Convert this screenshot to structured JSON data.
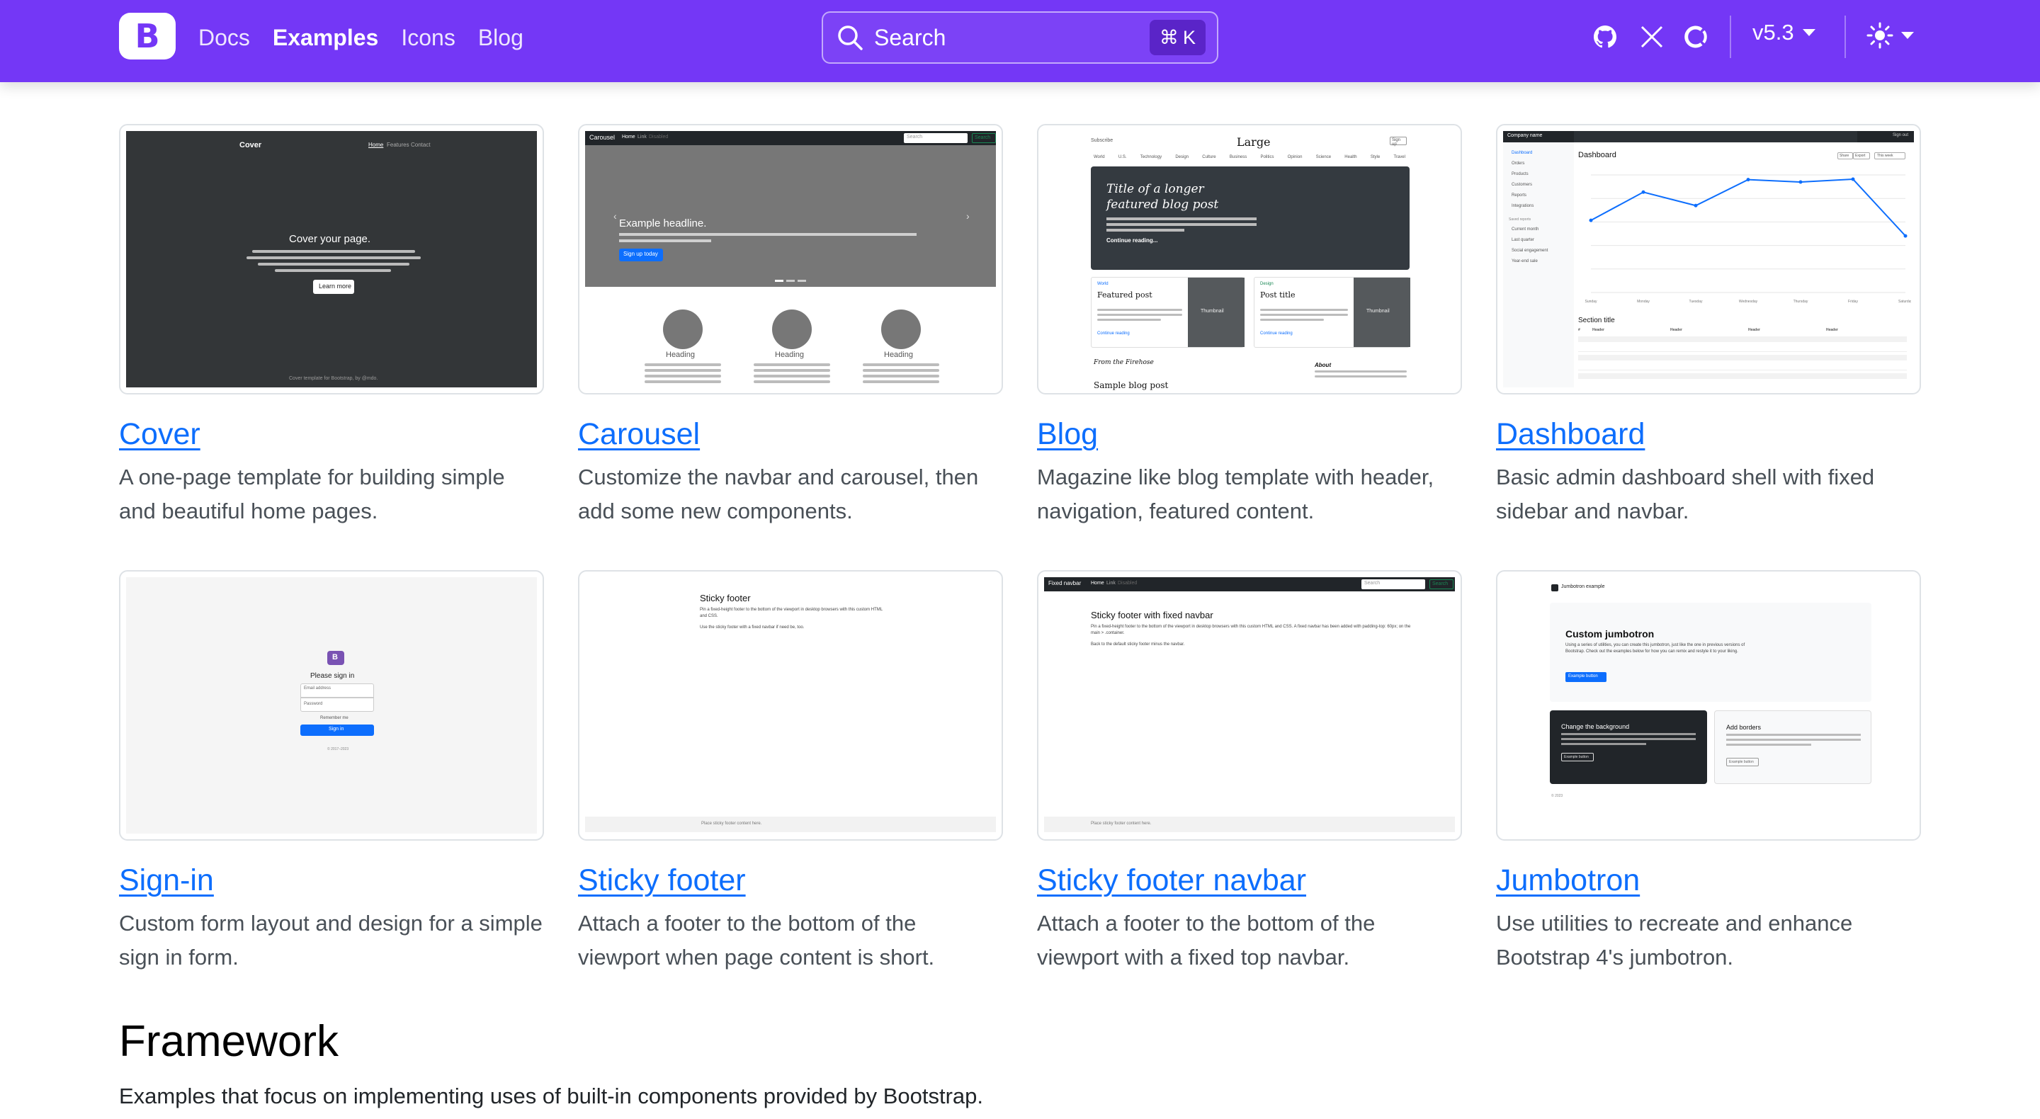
{
  "navbar": {
    "brand_letter": "B",
    "links": [
      {
        "label": "Docs",
        "active": false
      },
      {
        "label": "Examples",
        "active": true
      },
      {
        "label": "Icons",
        "active": false
      },
      {
        "label": "Blog",
        "active": false
      }
    ],
    "search": {
      "label": "Search",
      "shortcut_symbol": "⌘",
      "shortcut_key": "K"
    },
    "version": "v5.3",
    "icons": [
      "github-icon",
      "x-twitter-icon",
      "opencollective-icon",
      "sun-icon"
    ],
    "background_color": "#7437f6"
  },
  "examples": [
    {
      "title": "Cover",
      "description": "A one-page template for building simple and beautiful home pages."
    },
    {
      "title": "Carousel",
      "description": "Customize the navbar and carousel, then add some new components."
    },
    {
      "title": "Blog",
      "description": "Magazine like blog template with header, navigation, featured content."
    },
    {
      "title": "Dashboard",
      "description": "Basic admin dashboard shell with fixed sidebar and navbar."
    },
    {
      "title": "Sign-in",
      "description": "Custom form layout and design for a simple sign in form."
    },
    {
      "title": "Sticky footer",
      "description": "Attach a footer to the bottom of the viewport when page content is short."
    },
    {
      "title": "Sticky footer navbar",
      "description": "Attach a footer to the bottom of the viewport with a fixed top navbar."
    },
    {
      "title": "Jumbotron",
      "description": "Use utilities to recreate and enhance Bootstrap 4's jumbotron."
    }
  ],
  "thumbs": {
    "cover": {
      "brand": "Cover",
      "nav": [
        "Home",
        "Features",
        "Contact"
      ],
      "headline": "Cover your page.",
      "button": "Learn more",
      "footer": "Cover template for Bootstrap, by @mdo."
    },
    "carousel": {
      "brand": "Carousel",
      "nav": [
        "Home",
        "Link",
        "Disabled"
      ],
      "search": "Search",
      "search_button": "Search",
      "headline": "Example headline.",
      "button": "Sign up today",
      "headings": [
        "Heading",
        "Heading",
        "Heading"
      ]
    },
    "blog": {
      "subscribe": "Subscribe",
      "title": "Large",
      "signup": "Sign up",
      "nav": [
        "World",
        "U.S.",
        "Technology",
        "Design",
        "Culture",
        "Business",
        "Politics",
        "Opinion",
        "Science",
        "Health",
        "Style",
        "Travel"
      ],
      "hero_line1": "Title of a longer",
      "hero_line2": "featured blog post",
      "hero_link": "Continue reading...",
      "card1_tag": "World",
      "card1_title": "Featured post",
      "card2_tag": "Design",
      "card2_title": "Post title",
      "thumbnail": "Thumbnail",
      "continue": "Continue reading",
      "firehose": "From the Firehose",
      "sample": "Sample blog post",
      "about": "About"
    },
    "dashboard": {
      "company": "Company name",
      "signout": "Sign out",
      "title": "Dashboard",
      "section": "Section title",
      "sidebar": [
        "Dashboard",
        "Orders",
        "Products",
        "Customers",
        "Reports",
        "Integrations"
      ],
      "saved": "Saved reports",
      "saved_items": [
        "Current month",
        "Last quarter",
        "Social engagement",
        "Year-end sale"
      ],
      "buttons": [
        "Share",
        "Export",
        "This week"
      ],
      "table_headers": [
        "#",
        "Header",
        "Header",
        "Header",
        "Header"
      ],
      "chart_values": [
        15339,
        21345,
        18483,
        24003,
        23489,
        24092,
        12034
      ],
      "days": [
        "Sunday",
        "Monday",
        "Tuesday",
        "Wednesday",
        "Thursday",
        "Friday",
        "Saturday"
      ]
    },
    "signin": {
      "logo": "B",
      "heading": "Please sign in",
      "email": "Email address",
      "password": "Password",
      "remember": "Remember me",
      "button": "Sign in",
      "footer": "© 2017–2023"
    },
    "sticky": {
      "title": "Sticky footer",
      "text": "Pin a fixed-height footer to the bottom of the viewport in desktop browsers with this custom HTML and CSS.",
      "link_text": "Use the sticky footer with a fixed navbar if need be, too.",
      "footer": "Place sticky footer content here."
    },
    "stickynav": {
      "brand": "Fixed navbar",
      "nav": [
        "Home",
        "Link",
        "Disabled"
      ],
      "search": "Search",
      "search_button": "Search",
      "title": "Sticky footer with fixed navbar",
      "text": "Pin a fixed-height footer to the bottom of the viewport in desktop browsers with this custom HTML and CSS. A fixed navbar has been added with padding-top: 60px; on the main > .container.",
      "link_text": "Back to the default sticky footer minus the navbar.",
      "footer": "Place sticky footer content here."
    },
    "jumbo": {
      "brand": "Jumbotron example",
      "title": "Custom jumbotron",
      "text": "Using a series of utilities, you can create this jumbotron, just like the one in previous versions of Bootstrap. Check out the examples below for how you can remix and restyle it to your liking.",
      "button": "Example button",
      "left_title": "Change the background",
      "left_button": "Example button",
      "right_title": "Add borders",
      "right_button": "Example button",
      "footer": "© 2023"
    }
  },
  "framework": {
    "title": "Framework",
    "description": "Examples that focus on implementing uses of built-in components provided by Bootstrap."
  }
}
